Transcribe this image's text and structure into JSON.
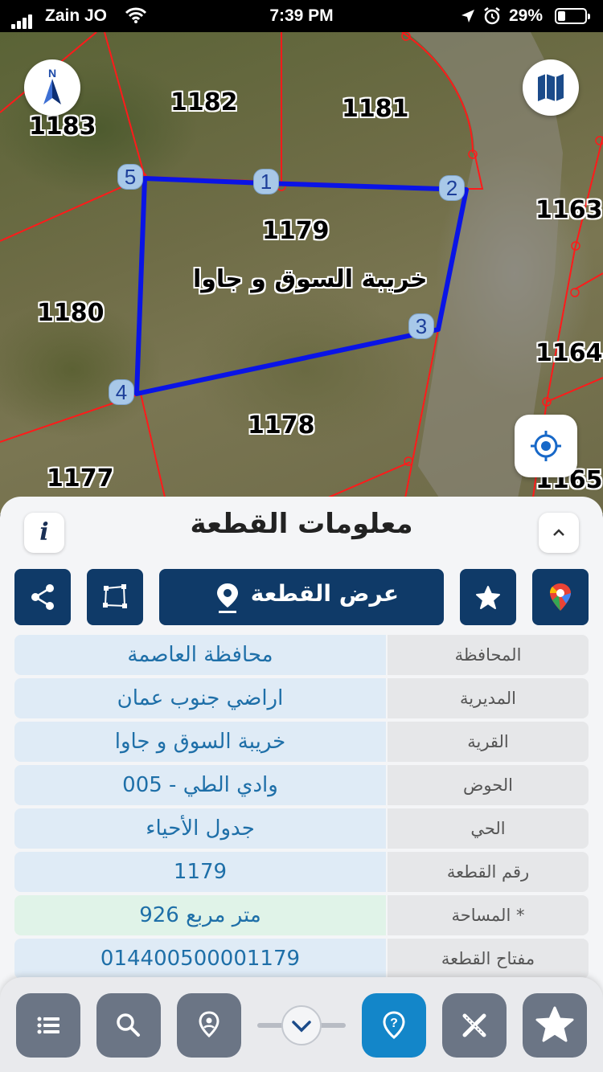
{
  "status_bar": {
    "carrier": "Zain JO",
    "time": "7:39 PM",
    "battery_percent": "29%",
    "battery_level": 0.29
  },
  "map": {
    "parcels": [
      {
        "number": "1183"
      },
      {
        "number": "1182"
      },
      {
        "number": "1181"
      },
      {
        "number": "1180"
      },
      {
        "number": "1179",
        "village": "خريبة السوق  و جاوا"
      },
      {
        "number": "1178"
      },
      {
        "number": "1177"
      },
      {
        "number": "1163"
      },
      {
        "number": "1164"
      },
      {
        "number": "1165"
      }
    ],
    "vertices": [
      "1",
      "2",
      "3",
      "4",
      "5"
    ],
    "compass_letter": "N",
    "colors": {
      "parcel_boundary": "#ff1a1a",
      "selected_parcel": "#0a14e6"
    }
  },
  "panel": {
    "title": "معلومات القطعة",
    "info_button": "i",
    "show_parcel_label": "عرض القطعة",
    "rows": [
      {
        "label": "المحافظة",
        "value": "محافظة العاصمة"
      },
      {
        "label": "المديرية",
        "value": "اراضي جنوب عمان"
      },
      {
        "label": "القرية",
        "value": "خريبة السوق  و جاوا"
      },
      {
        "label": "الحوض",
        "value": "وادي الطي - 005"
      },
      {
        "label": "الحي",
        "value": "جدول الأحياء"
      },
      {
        "label": "رقم القطعة",
        "value": "1179"
      },
      {
        "label": "المساحة *",
        "value": "926  متر مربع"
      },
      {
        "label": "مفتاح القطعة",
        "value": "014400500001179"
      }
    ],
    "colors": {
      "primary": "#0f3a68",
      "value_text": "#1e6fa8",
      "value_bg": "#dfebf6",
      "area_bg": "#e0f3e8"
    }
  },
  "bottom_nav": {
    "items": [
      "list-icon",
      "search-icon",
      "location-pin-icon",
      "help-icon",
      "tools-icon",
      "star-icon"
    ],
    "active": "help-icon",
    "colors": {
      "default": "#6b7585",
      "active": "#1386c9"
    }
  }
}
